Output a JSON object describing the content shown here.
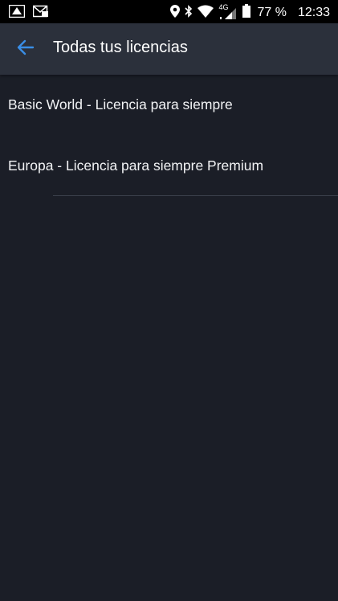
{
  "status_bar": {
    "battery_percent": "77 %",
    "time": "12:33",
    "network": "4G",
    "icons": [
      "alert-icon",
      "message-icon",
      "location-icon",
      "bluetooth-icon",
      "wifi-icon",
      "signal-icon",
      "battery-icon"
    ]
  },
  "app_bar": {
    "title": "Todas tus licencias",
    "back_icon": "arrow-left-icon",
    "accent": "#3a8ee6"
  },
  "licenses": [
    {
      "label": "Basic World - Licencia para siempre"
    },
    {
      "label": "Europa - Licencia para siempre Premium"
    }
  ],
  "colors": {
    "background": "#1b1e27",
    "app_bar": "#2b303b",
    "status_bar": "#000000"
  }
}
